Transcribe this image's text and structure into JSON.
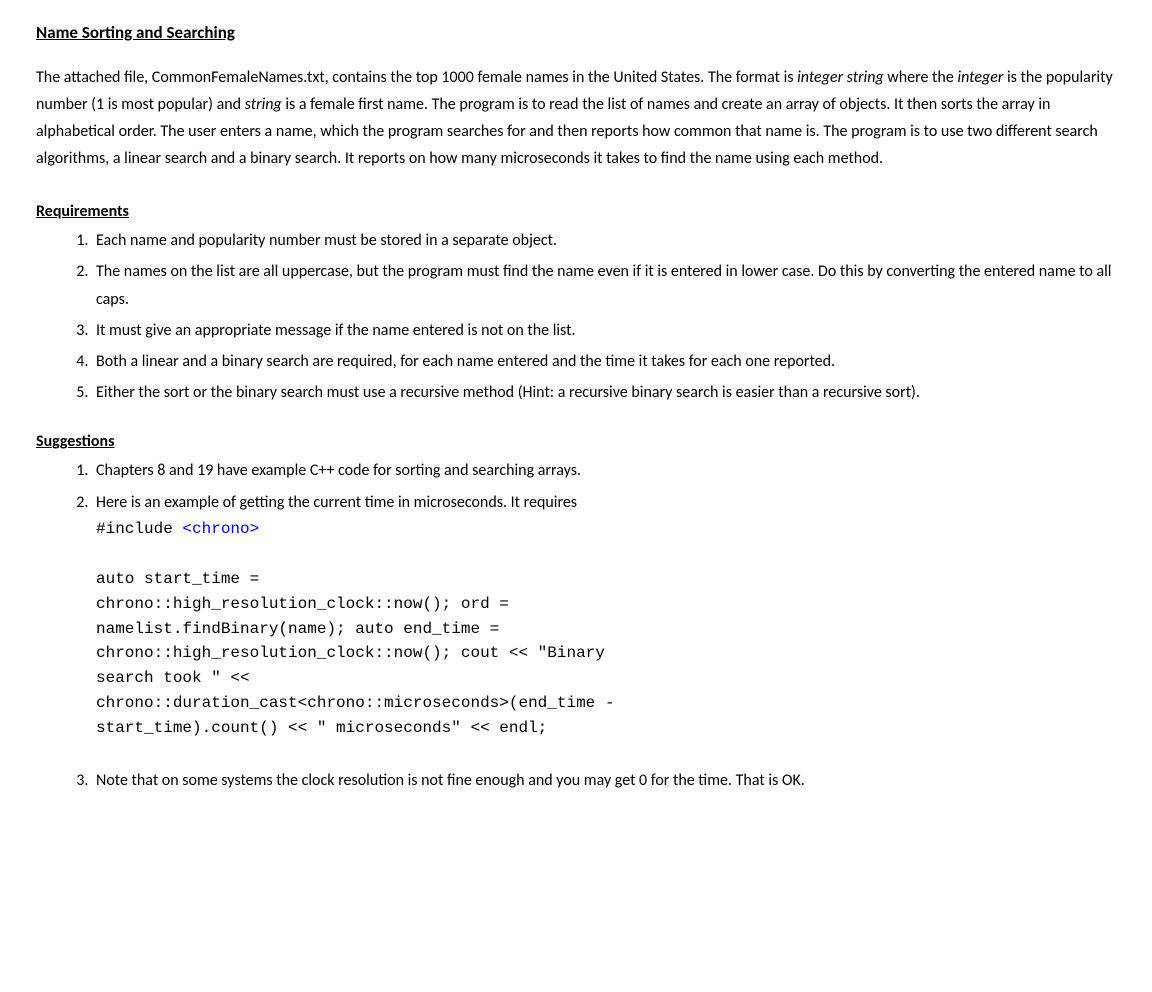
{
  "title": "Name Sorting and Searching",
  "body": {
    "p1a": "The attached file, CommonFemaleNames.txt, contains the top 1000 female names in the United States. The format is ",
    "p1b": "integer string",
    "p1c": " where the ",
    "p1d": "integer",
    "p1e": " is the popularity number (1 is most popular) and ",
    "p1f": "string",
    "p1g": " is a female first name. The program is to read the list of names and create an array of objects. It then sorts the array in alphabetical order. The user enters a name, which the program searches for and then reports how common that name is. The program is to use two different search algorithms, a linear search and a binary search. It reports on how many microseconds it takes to find the name using each method."
  },
  "requirements": {
    "heading": "Requirements",
    "items": [
      "Each name and popularity number must be stored in a separate object.",
      "The names on the list are all uppercase, but the program must find the name even if it is entered in lower case. Do this by converting the entered name to all caps.",
      "It must give an appropriate message if the name entered is not on the list.",
      "Both a linear and a binary search are required, for each name entered and the time it takes for each one reported.",
      "Either the sort or the binary search must use a recursive method (Hint: a recursive binary search is easier than a recursive sort)."
    ]
  },
  "suggestions": {
    "heading": "Suggestions",
    "item1": "Chapters 8 and 19 have example C++ code for sorting and searching arrays.",
    "item2": "Here is an example of getting the current time in microseconds. It requires",
    "include_a": "#include ",
    "include_b": "<chrono>",
    "code": {
      "l1": "auto start_time =",
      "l2": "chrono::high_resolution_clock::now(); ord =",
      "l3": "namelist.findBinary(name); auto end_time =",
      "l4": "chrono::high_resolution_clock::now(); cout << \"Binary",
      "l5": "search took \" <<",
      "l6": "chrono::duration_cast<chrono::microseconds>(end_time -",
      "l7": "start_time).count() << \" microseconds\" << endl;"
    },
    "item3": "Note that on some systems the clock resolution is not fine enough and you may get 0 for the time. That is OK."
  }
}
